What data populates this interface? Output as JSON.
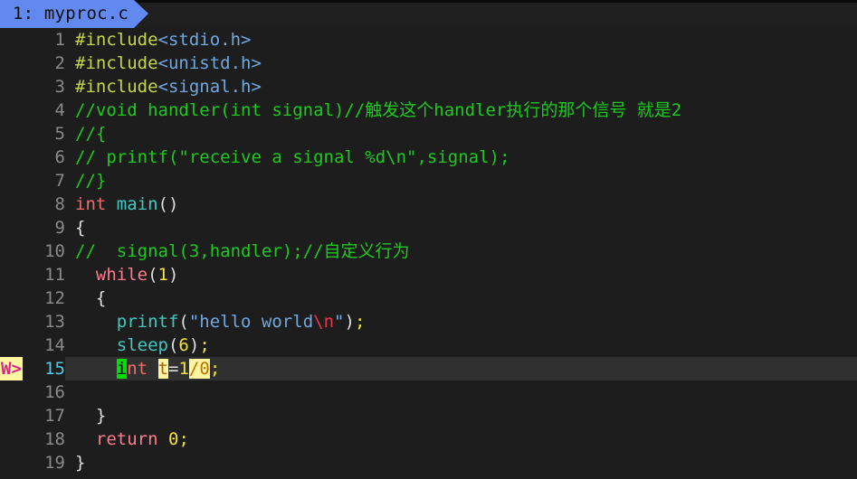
{
  "app": {
    "name": "vim-editor"
  },
  "tabline": {
    "tabs": [
      {
        "label": "1: myproc.c",
        "active": true
      }
    ]
  },
  "colors": {
    "background": "#1d1d1d",
    "tab_active": "#6189f0",
    "cursorline": "#303030",
    "cursor_block": "#00e000",
    "sign_warn_bg": "#fdf6a0",
    "sign_warn_fg": "#e0218a",
    "linenr": "#8a8a8a",
    "linenr_current": "#56c8e8",
    "preproc": "#c5d64a",
    "include_path": "#70a8e0",
    "comment": "#1ec91e",
    "type": "#f06a6a",
    "keyword": "#ff7b8e",
    "function": "#3ec9c0",
    "string": "#70a8e0",
    "escape": "#f0324b",
    "number": "#f2e03c",
    "punctuation": "#dfdfdf",
    "error_hl_bg": "#fdf6a0",
    "error_hl_fg": "#c07000"
  },
  "buffer": {
    "filename": "myproc.c",
    "lines": [
      {
        "num": "1",
        "sign": "",
        "current": false,
        "text": "#include<stdio.h>"
      },
      {
        "num": "2",
        "sign": "",
        "current": false,
        "text": "#include<unistd.h>"
      },
      {
        "num": "3",
        "sign": "",
        "current": false,
        "text": "#include<signal.h>"
      },
      {
        "num": "4",
        "sign": "",
        "current": false,
        "text": "//void handler(int signal)//触发这个handler执行的那个信号 就是2"
      },
      {
        "num": "5",
        "sign": "",
        "current": false,
        "text": "//{"
      },
      {
        "num": "6",
        "sign": "",
        "current": false,
        "text": "// printf(\"receive a signal %d\\n\",signal);"
      },
      {
        "num": "7",
        "sign": "",
        "current": false,
        "text": "//}"
      },
      {
        "num": "8",
        "sign": "",
        "current": false,
        "text": "int main()"
      },
      {
        "num": "9",
        "sign": "",
        "current": false,
        "text": "{"
      },
      {
        "num": "10",
        "sign": "",
        "current": false,
        "text": "//  signal(3,handler);//自定义行为"
      },
      {
        "num": "11",
        "sign": "",
        "current": false,
        "text": "  while(1)"
      },
      {
        "num": "12",
        "sign": "",
        "current": false,
        "text": "  {"
      },
      {
        "num": "13",
        "sign": "",
        "current": false,
        "text": "    printf(\"hello world\\n\");"
      },
      {
        "num": "14",
        "sign": "",
        "current": false,
        "text": "    sleep(6);"
      },
      {
        "num": "15",
        "sign": "W>",
        "current": true,
        "text": "    int t=1/0;"
      },
      {
        "num": "16",
        "sign": "",
        "current": false,
        "text": ""
      },
      {
        "num": "17",
        "sign": "",
        "current": false,
        "text": "  }"
      },
      {
        "num": "18",
        "sign": "",
        "current": false,
        "text": "  return 0;"
      },
      {
        "num": "19",
        "sign": "",
        "current": false,
        "text": "}"
      }
    ]
  },
  "tokens": {
    "l1": [
      {
        "t": "#include",
        "c": "t-pre"
      },
      {
        "t": "<stdio.h>",
        "c": "t-inc"
      }
    ],
    "l2": [
      {
        "t": "#include",
        "c": "t-pre"
      },
      {
        "t": "<unistd.h>",
        "c": "t-inc"
      }
    ],
    "l3": [
      {
        "t": "#include",
        "c": "t-pre"
      },
      {
        "t": "<signal.h>",
        "c": "t-inc"
      }
    ],
    "l4": [
      {
        "t": "//void handler(int signal)//触发这个handler执行的那个信号 就是2",
        "c": "t-cmt"
      }
    ],
    "l5": [
      {
        "t": "//{",
        "c": "t-cmt"
      }
    ],
    "l6": [
      {
        "t": "// printf(\"receive a signal %d\\n\",signal);",
        "c": "t-cmt"
      }
    ],
    "l7": [
      {
        "t": "//}",
        "c": "t-cmt"
      }
    ],
    "l8": [
      {
        "t": "int",
        "c": "t-type"
      },
      {
        "t": " ",
        "c": "t-op"
      },
      {
        "t": "main",
        "c": "t-func"
      },
      {
        "t": "()",
        "c": "t-punc"
      }
    ],
    "l9": [
      {
        "t": "{",
        "c": "t-punc"
      }
    ],
    "l10": [
      {
        "t": "//  signal(3,handler);//自定义行为",
        "c": "t-cmt"
      }
    ],
    "l11": [
      {
        "t": "  ",
        "c": "t-op"
      },
      {
        "t": "while",
        "c": "t-kw"
      },
      {
        "t": "(",
        "c": "t-punc"
      },
      {
        "t": "1",
        "c": "t-num"
      },
      {
        "t": ")",
        "c": "t-punc"
      }
    ],
    "l12": [
      {
        "t": "  ",
        "c": "t-op"
      },
      {
        "t": "{",
        "c": "t-punc"
      }
    ],
    "l13": [
      {
        "t": "    ",
        "c": "t-op"
      },
      {
        "t": "printf",
        "c": "t-func"
      },
      {
        "t": "(",
        "c": "t-punc"
      },
      {
        "t": "\"hello world",
        "c": "t-str"
      },
      {
        "t": "\\n",
        "c": "t-esc"
      },
      {
        "t": "\"",
        "c": "t-str"
      },
      {
        "t": ")",
        "c": "t-punc"
      },
      {
        "t": ";",
        "c": "t-num"
      }
    ],
    "l14": [
      {
        "t": "    ",
        "c": "t-op"
      },
      {
        "t": "sleep",
        "c": "t-func"
      },
      {
        "t": "(",
        "c": "t-punc"
      },
      {
        "t": "6",
        "c": "t-num"
      },
      {
        "t": ")",
        "c": "t-punc"
      },
      {
        "t": ";",
        "c": "t-num"
      }
    ],
    "l15": [
      {
        "t": "    ",
        "c": "t-op"
      },
      {
        "t": "i",
        "c": "cursor-blk"
      },
      {
        "t": "nt",
        "c": "t-type"
      },
      {
        "t": " ",
        "c": "t-op"
      },
      {
        "t": "t",
        "c": "hl-err-dark"
      },
      {
        "t": "=",
        "c": "t-op"
      },
      {
        "t": "1",
        "c": "t-num"
      },
      {
        "t": "/0",
        "c": "hl-err"
      },
      {
        "t": ";",
        "c": "t-num"
      }
    ],
    "l16": [],
    "l17": [
      {
        "t": "  ",
        "c": "t-op"
      },
      {
        "t": "}",
        "c": "t-punc"
      }
    ],
    "l18": [
      {
        "t": "  ",
        "c": "t-op"
      },
      {
        "t": "return",
        "c": "t-kw"
      },
      {
        "t": " ",
        "c": "t-op"
      },
      {
        "t": "0",
        "c": "t-num"
      },
      {
        "t": ";",
        "c": "t-num"
      }
    ],
    "l19": [
      {
        "t": "}",
        "c": "t-punc"
      }
    ]
  }
}
